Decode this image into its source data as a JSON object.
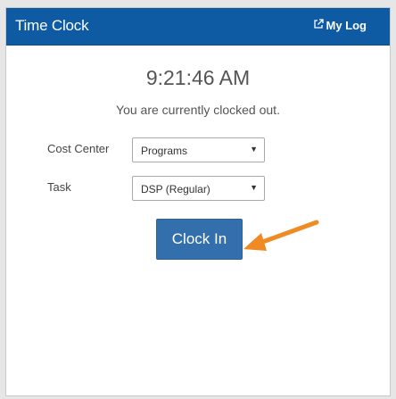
{
  "header": {
    "title": "Time Clock",
    "my_log_label": "My Log",
    "my_log_icon": "external-link-icon",
    "background_color": "#0e5aa3"
  },
  "clock": {
    "time": "9:21:46 AM",
    "status": "You are currently clocked out."
  },
  "form": {
    "cost_center_label": "Cost Center",
    "cost_center_value": "Programs",
    "task_label": "Task",
    "task_value": "DSP (Regular)"
  },
  "action": {
    "clock_in_label": "Clock In",
    "button_color": "#336fac"
  },
  "annotation": {
    "arrow_color": "#f08a24"
  }
}
